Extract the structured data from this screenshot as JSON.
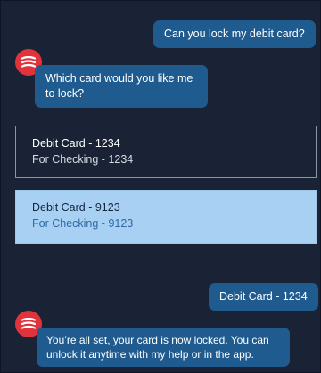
{
  "chat": {
    "user_message_1": "Can you lock my debit card?",
    "bot_message_1": "Which card would you like me to lock?",
    "card_options": [
      {
        "title": "Debit Card - 1234",
        "subtitle": "For Checking - 1234",
        "selected": false
      },
      {
        "title": "Debit Card - 9123",
        "subtitle": "For Checking - 9123",
        "selected": true
      }
    ],
    "user_message_2": "Debit Card - 1234",
    "bot_message_2": "You’re all set, your card is now locked.  You can unlock it anytime with my help or in the app."
  },
  "colors": {
    "background": "#1a2336",
    "bubble": "#1f5b8f",
    "avatar": "#e0333b",
    "selected_card": "#a7d0f2",
    "selected_subtitle": "#2f6aa5"
  },
  "icons": {
    "assistant_avatar": "striped-logo-icon"
  }
}
